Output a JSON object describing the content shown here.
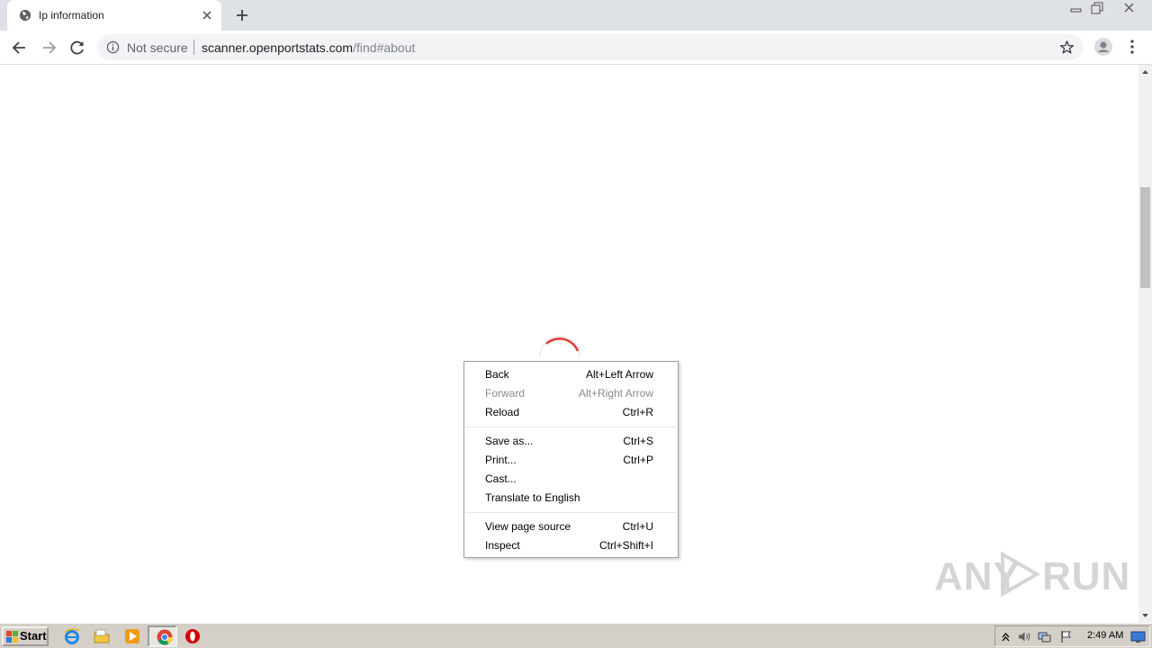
{
  "browser": {
    "tab": {
      "title": "Ip information",
      "favicon": "globe-icon",
      "close_icon": "close-icon"
    },
    "new_tab_icon": "plus-icon",
    "window_controls": [
      "minimize-icon",
      "restore-icon",
      "close-icon"
    ],
    "toolbar": {
      "back_icon": "arrow-left-icon",
      "forward_icon": "arrow-right-icon",
      "reload_icon": "reload-icon",
      "security_icon": "info-icon",
      "security_label": "Not secure",
      "url_host": "scanner.openportstats.com",
      "url_path": "/find#about",
      "bookmark_icon": "star-icon",
      "profile_icon": "account-icon",
      "menu_icon": "more-vert-icon"
    }
  },
  "page": {
    "loading_indicator": "spinner-icon"
  },
  "context_menu": {
    "groups": [
      [
        {
          "label": "Back",
          "shortcut": "Alt+Left Arrow",
          "enabled": true
        },
        {
          "label": "Forward",
          "shortcut": "Alt+Right Arrow",
          "enabled": false
        },
        {
          "label": "Reload",
          "shortcut": "Ctrl+R",
          "enabled": true
        }
      ],
      [
        {
          "label": "Save as...",
          "shortcut": "Ctrl+S",
          "enabled": true
        },
        {
          "label": "Print...",
          "shortcut": "Ctrl+P",
          "enabled": true
        },
        {
          "label": "Cast...",
          "shortcut": "",
          "enabled": true
        },
        {
          "label": "Translate to English",
          "shortcut": "",
          "enabled": true
        }
      ],
      [
        {
          "label": "View page source",
          "shortcut": "Ctrl+U",
          "enabled": true
        },
        {
          "label": "Inspect",
          "shortcut": "Ctrl+Shift+I",
          "enabled": true
        }
      ]
    ]
  },
  "watermark": {
    "text_left": "ANY",
    "text_right": "RUN"
  },
  "taskbar": {
    "start_label": "Start",
    "quick_launch": [
      "internet-explorer-icon",
      "folder-icon",
      "media-player-icon",
      "chrome-icon",
      "opera-icon"
    ],
    "tray_icons": [
      "show-hidden-icon",
      "speaker-icon",
      "network-icon",
      "action-center-flag-icon",
      "show-desktop-icon"
    ],
    "clock": "2:49 AM"
  },
  "colors": {
    "tab_strip": "#dee1e6",
    "omnibox": "#f1f3f4",
    "spinner": "#e53935",
    "taskbar": "#d4d0c8"
  }
}
